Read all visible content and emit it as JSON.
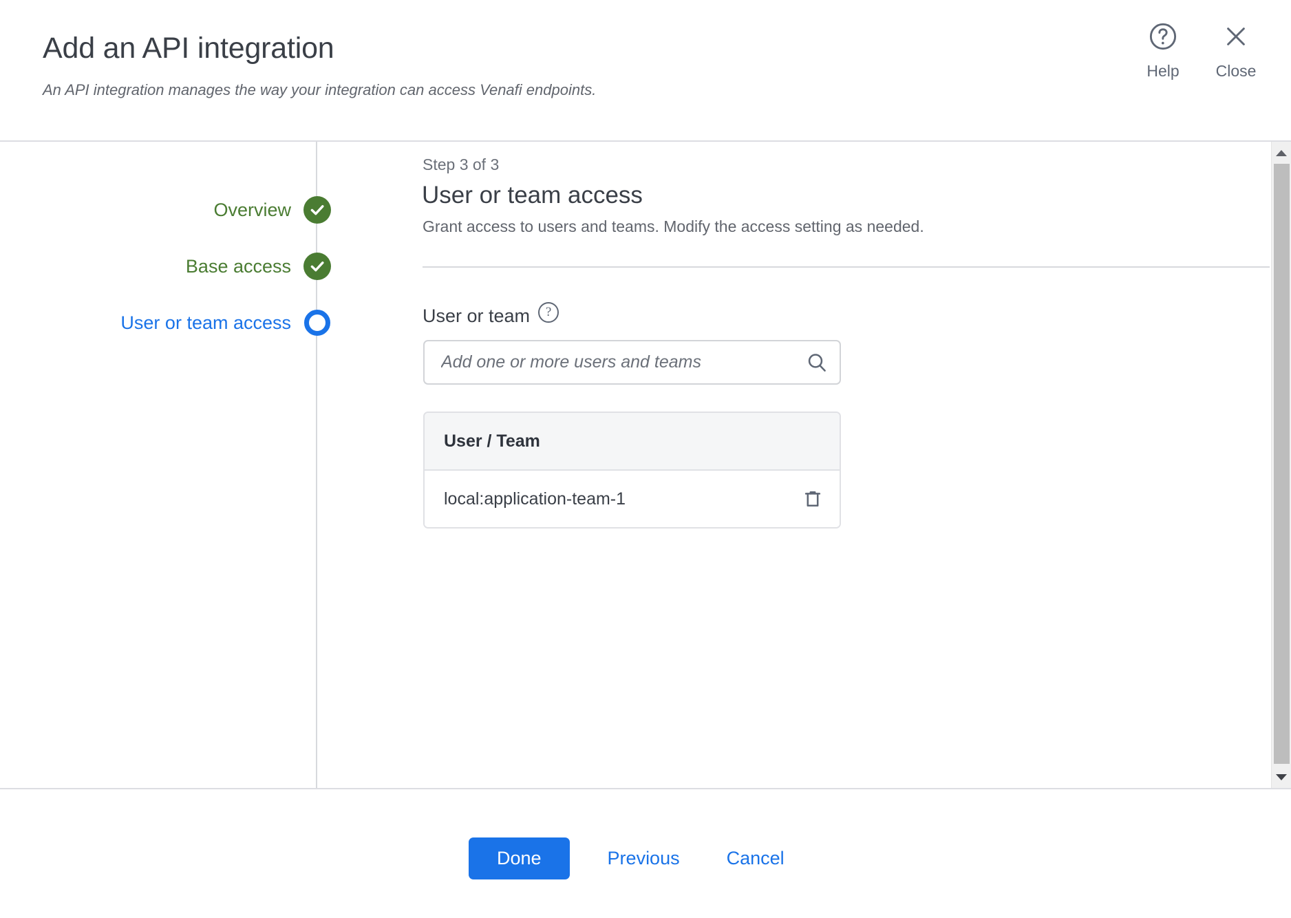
{
  "dialog": {
    "title": "Add an API integration",
    "subtitle": "An API integration manages the way your integration can access Venafi endpoints."
  },
  "header_actions": {
    "help_label": "Help",
    "help_icon": "question-circle-icon",
    "close_label": "Close",
    "close_icon": "close-icon"
  },
  "wizard": {
    "steps": [
      {
        "label": "Overview",
        "state": "done",
        "marker_icon": "check-circle-icon"
      },
      {
        "label": "Base access",
        "state": "done",
        "marker_icon": "check-circle-icon"
      },
      {
        "label": "User or team access",
        "state": "current",
        "marker_icon": "current-step-circle-icon"
      }
    ]
  },
  "main": {
    "step_counter": "Step 3 of 3",
    "title": "User or team access",
    "description": "Grant access to users and teams. Modify the access setting as needed.",
    "field": {
      "label": "User or team",
      "help_icon": "help-question-icon",
      "search_placeholder": "Add one or more users and teams",
      "search_value": "",
      "search_icon": "search-icon"
    },
    "table": {
      "columns": [
        "User / Team"
      ],
      "rows": [
        {
          "name": "local:application-team-1",
          "delete_icon": "trash-icon"
        }
      ]
    }
  },
  "scrollbar": {
    "up_icon": "chevron-up-icon",
    "down_icon": "chevron-down-icon"
  },
  "footer": {
    "done_label": "Done",
    "previous_label": "Previous",
    "cancel_label": "Cancel"
  },
  "colors": {
    "accent_blue": "#1a73e8",
    "done_green": "#4a7c32",
    "text_dark": "#3a3f47",
    "text_muted": "#61656d",
    "border": "#d7d9dd"
  }
}
